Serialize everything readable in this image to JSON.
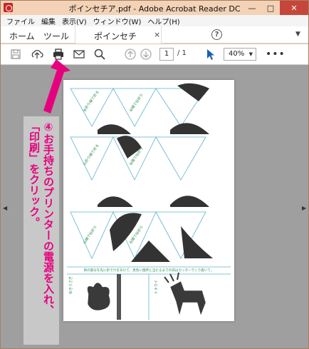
{
  "window": {
    "title": "ポインセチア.pdf - Adobe Acrobat Reader DC",
    "controls": {
      "minimize": "—",
      "maximize": "□",
      "close": "✕"
    }
  },
  "menu": [
    "ファイル",
    "編集",
    "表示(V)",
    "ウィンドウ(W)",
    "ヘルプ(H)"
  ],
  "tabs": {
    "home": "ホーム",
    "tools": "ツール",
    "document": "ポインセチア.pdf",
    "close": "×",
    "help": "?",
    "chevron": "▼"
  },
  "toolbar": {
    "icons": [
      "save-icon",
      "upload-icon",
      "print-icon",
      "email-icon",
      "search-icon",
      "page-up-icon",
      "page-down-icon",
      "select-cursor-icon",
      "more-icon"
    ],
    "page_current": "1",
    "page_total": "/ 1",
    "zoom": "40%",
    "more": "•••"
  },
  "document": {
    "page_text": {
      "instruction": "目の部分を先に針で穴をあけて、黒色い箇所と当たるまでの白はカッターでくり抜いて。",
      "cut_label_1": "ゆきうさぎ",
      "cut_label_2": "トナカイ"
    },
    "fold_labels": [
      "谷折り線で折る",
      "谷線で谷折り",
      "山折り線で折る",
      "谷線で谷折り",
      "山線で谷折り",
      "谷線で谷折り"
    ]
  },
  "annotation": {
    "callout_lines": [
      "④お手持ちのプリンターの電源を入れ、",
      "「印刷」をクリック。"
    ],
    "arrow_color": "#e6007e"
  },
  "colors": {
    "accent_pink": "#e6007e",
    "title_bg": "#f3d2b6",
    "doc_bg": "#9f9f9f",
    "acrobat_red": "#c62828"
  }
}
